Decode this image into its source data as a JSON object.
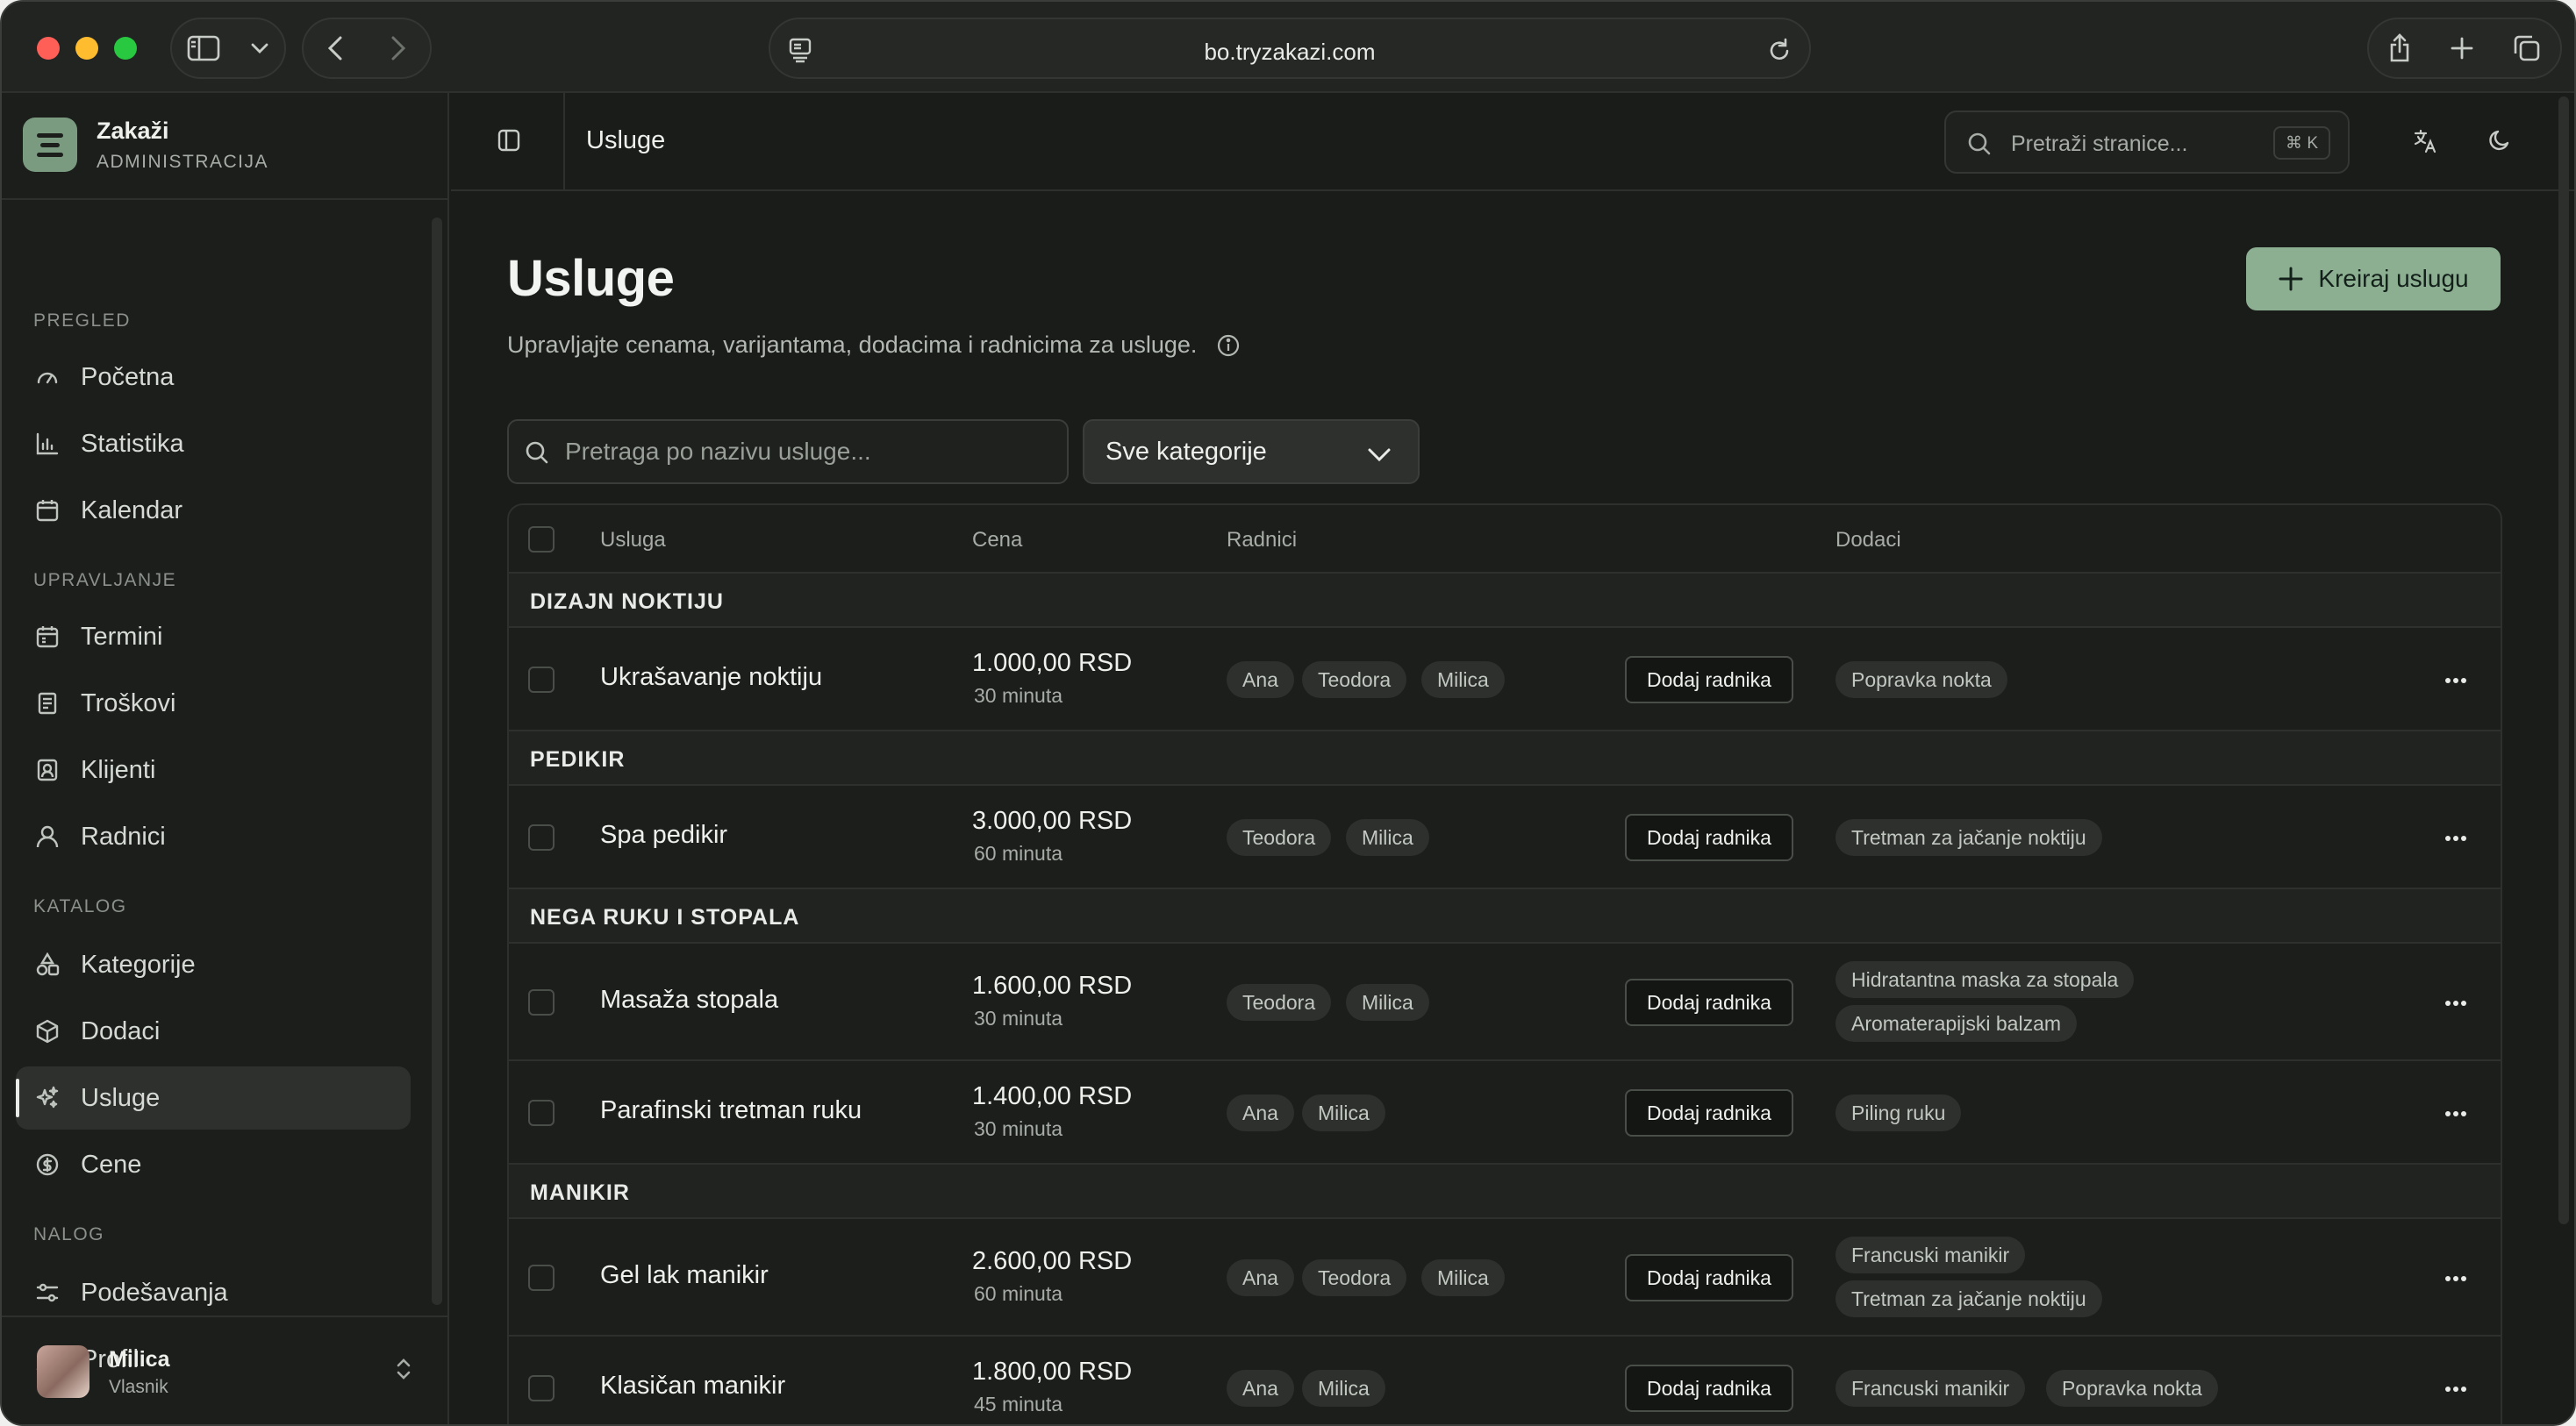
{
  "browser": {
    "url": "bo.tryzakazi.com"
  },
  "sidebar": {
    "brand_name": "Zakaži",
    "brand_sub": "ADMINISTRACIJA",
    "sections": [
      {
        "title": "PREGLED",
        "items": [
          {
            "label": "Početna",
            "icon": "gauge-icon"
          },
          {
            "label": "Statistika",
            "icon": "chart-icon"
          },
          {
            "label": "Kalendar",
            "icon": "calendar-icon"
          }
        ]
      },
      {
        "title": "UPRAVLJANJE",
        "items": [
          {
            "label": "Termini",
            "icon": "calendar-check-icon"
          },
          {
            "label": "Troškovi",
            "icon": "receipt-icon"
          },
          {
            "label": "Klijenti",
            "icon": "contact-icon"
          },
          {
            "label": "Radnici",
            "icon": "user-icon"
          }
        ]
      },
      {
        "title": "KATALOG",
        "items": [
          {
            "label": "Kategorije",
            "icon": "shapes-icon"
          },
          {
            "label": "Dodaci",
            "icon": "package-icon"
          },
          {
            "label": "Usluge",
            "icon": "sparkles-icon",
            "active": true
          },
          {
            "label": "Cene",
            "icon": "dollar-circle-icon"
          }
        ]
      },
      {
        "title": "NALOG",
        "items": [
          {
            "label": "Podešavanja",
            "icon": "settings-sliders-icon"
          },
          {
            "label": "Profil",
            "icon": "profile-icon"
          }
        ]
      }
    ],
    "user": {
      "name": "Milica",
      "role": "Vlasnik"
    }
  },
  "topbar": {
    "title": "Usluge",
    "search_placeholder": "Pretraži stranice...",
    "search_shortcut": "⌘ K"
  },
  "page": {
    "title": "Usluge",
    "description": "Upravljajte cenama, varijantama, dodacima i radnicima za usluge.",
    "create_button": "Kreiraj uslugu",
    "search_placeholder": "Pretraga po nazivu usluge...",
    "category_filter": "Sve kategorije"
  },
  "table": {
    "headers": {
      "service": "Usluga",
      "price": "Cena",
      "workers": "Radnici",
      "addons": "Dodaci"
    },
    "add_worker_label": "Dodaj radnika",
    "groups": [
      {
        "name": "DIZAJN NOKTIJU",
        "services": [
          {
            "name": "Ukrašavanje noktiju",
            "price": "1.000,00 RSD",
            "duration": "30 minuta",
            "workers": [
              "Ana",
              "Teodora",
              "Milica"
            ],
            "addons": [
              "Popravka nokta"
            ]
          }
        ]
      },
      {
        "name": "PEDIKIR",
        "services": [
          {
            "name": "Spa pedikir",
            "price": "3.000,00 RSD",
            "duration": "60 minuta",
            "workers": [
              "Teodora",
              "Milica"
            ],
            "addons": [
              "Tretman za jačanje noktiju"
            ]
          }
        ]
      },
      {
        "name": "NEGA RUKU I STOPALA",
        "services": [
          {
            "name": "Masaža stopala",
            "price": "1.600,00 RSD",
            "duration": "30 minuta",
            "workers": [
              "Teodora",
              "Milica"
            ],
            "addons": [
              "Hidratantna maska za stopala",
              "Aromaterapijski balzam"
            ]
          },
          {
            "name": "Parafinski tretman ruku",
            "price": "1.400,00 RSD",
            "duration": "30 minuta",
            "workers": [
              "Ana",
              "Milica"
            ],
            "addons": [
              "Piling ruku"
            ]
          }
        ]
      },
      {
        "name": "MANIKIR",
        "services": [
          {
            "name": "Gel lak manikir",
            "price": "2.600,00 RSD",
            "duration": "60 minuta",
            "workers": [
              "Ana",
              "Teodora",
              "Milica"
            ],
            "addons": [
              "Francuski manikir",
              "Tretman za jačanje noktiju"
            ]
          },
          {
            "name": "Klasičan manikir",
            "price": "1.800,00 RSD",
            "duration": "45 minuta",
            "workers": [
              "Ana",
              "Milica"
            ],
            "addons": [
              "Francuski manikir",
              "Popravka nokta"
            ]
          }
        ]
      }
    ]
  }
}
